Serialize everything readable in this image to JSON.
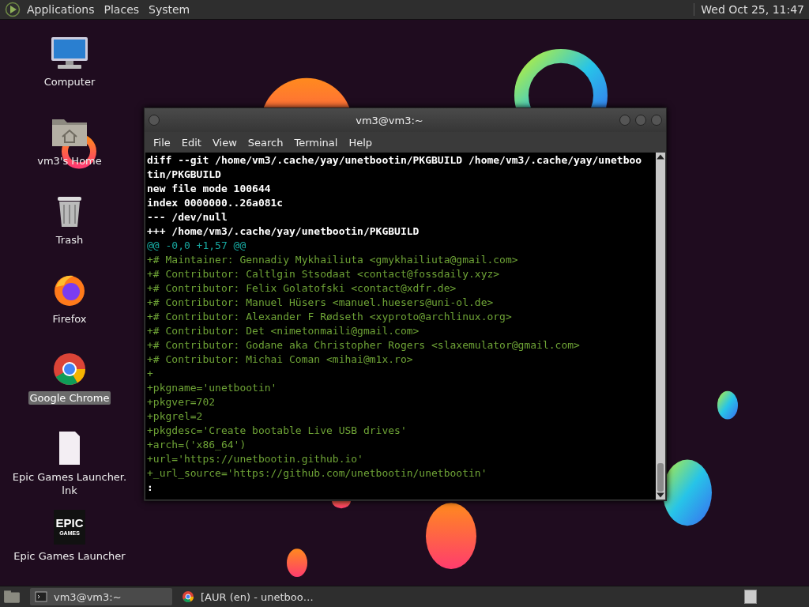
{
  "top_panel": {
    "menus": [
      "Applications",
      "Places",
      "System"
    ],
    "clock": "Wed Oct 25, 11:47"
  },
  "desktop_icons": [
    {
      "kind": "computer",
      "label": "Computer",
      "selected": false
    },
    {
      "kind": "folder",
      "label": "vm3's Home",
      "selected": false
    },
    {
      "kind": "trash",
      "label": "Trash",
      "selected": false
    },
    {
      "kind": "firefox",
      "label": "Firefox",
      "selected": false
    },
    {
      "kind": "chrome",
      "label": "Google Chrome",
      "selected": true
    },
    {
      "kind": "file",
      "label": "Epic Games Launcher.\nlnk",
      "selected": false
    },
    {
      "kind": "epic",
      "label": "Epic Games Launcher",
      "logo": [
        "EPIC",
        "GAMES"
      ],
      "selected": false
    }
  ],
  "terminal": {
    "title": "vm3@vm3:~",
    "menu": [
      "File",
      "Edit",
      "View",
      "Search",
      "Terminal",
      "Help"
    ],
    "lines": [
      {
        "kind": "header",
        "text": "diff --git /home/vm3/.cache/yay/unetbootin/PKGBUILD /home/vm3/.cache/yay/unetboo"
      },
      {
        "kind": "header",
        "text": "tin/PKGBUILD"
      },
      {
        "kind": "header",
        "text": "new file mode 100644"
      },
      {
        "kind": "header",
        "text": "index 0000000..26a081c"
      },
      {
        "kind": "header",
        "text": "--- /dev/null"
      },
      {
        "kind": "header",
        "text": "+++ /home/vm3/.cache/yay/unetbootin/PKGBUILD"
      },
      {
        "kind": "hunk",
        "text": "@@ -0,0 +1,57 @@"
      },
      {
        "kind": "added",
        "text": "+# Maintainer: Gennadiy Mykhailiuta <gmykhailiuta@gmail.com>"
      },
      {
        "kind": "added",
        "text": "+# Contributor: Caltlgin Stsodaat <contact@fossdaily.xyz>"
      },
      {
        "kind": "added",
        "text": "+# Contributor: Felix Golatofski <contact@xdfr.de>"
      },
      {
        "kind": "added",
        "text": "+# Contributor: Manuel Hüsers <manuel.huesers@uni-ol.de>"
      },
      {
        "kind": "added",
        "text": "+# Contributor: Alexander F Rødseth <xyproto@archlinux.org>"
      },
      {
        "kind": "added",
        "text": "+# Contributor: Det <nimetonmaili@gmail.com>"
      },
      {
        "kind": "added",
        "text": "+# Contributor: Godane aka Christopher Rogers <slaxemulator@gmail.com>"
      },
      {
        "kind": "added",
        "text": "+# Contributor: Michai Coman <mihai@m1x.ro>"
      },
      {
        "kind": "added",
        "text": "+"
      },
      {
        "kind": "added",
        "text": "+pkgname='unetbootin'"
      },
      {
        "kind": "added",
        "text": "+pkgver=702"
      },
      {
        "kind": "added",
        "text": "+pkgrel=2"
      },
      {
        "kind": "added",
        "text": "+pkgdesc='Create bootable Live USB drives'"
      },
      {
        "kind": "added",
        "text": "+arch=('x86_64')"
      },
      {
        "kind": "added",
        "text": "+url='https://unetbootin.github.io'"
      },
      {
        "kind": "added",
        "text": "+_url_source='https://github.com/unetbootin/unetbootin'"
      },
      {
        "kind": "prompt",
        "text": ":"
      }
    ]
  },
  "taskbar": {
    "tasks": [
      {
        "kind": "terminal",
        "label": "vm3@vm3:~",
        "selected": true
      },
      {
        "kind": "chrome",
        "label": "[AUR (en) - unetboo…",
        "selected": false
      }
    ]
  }
}
